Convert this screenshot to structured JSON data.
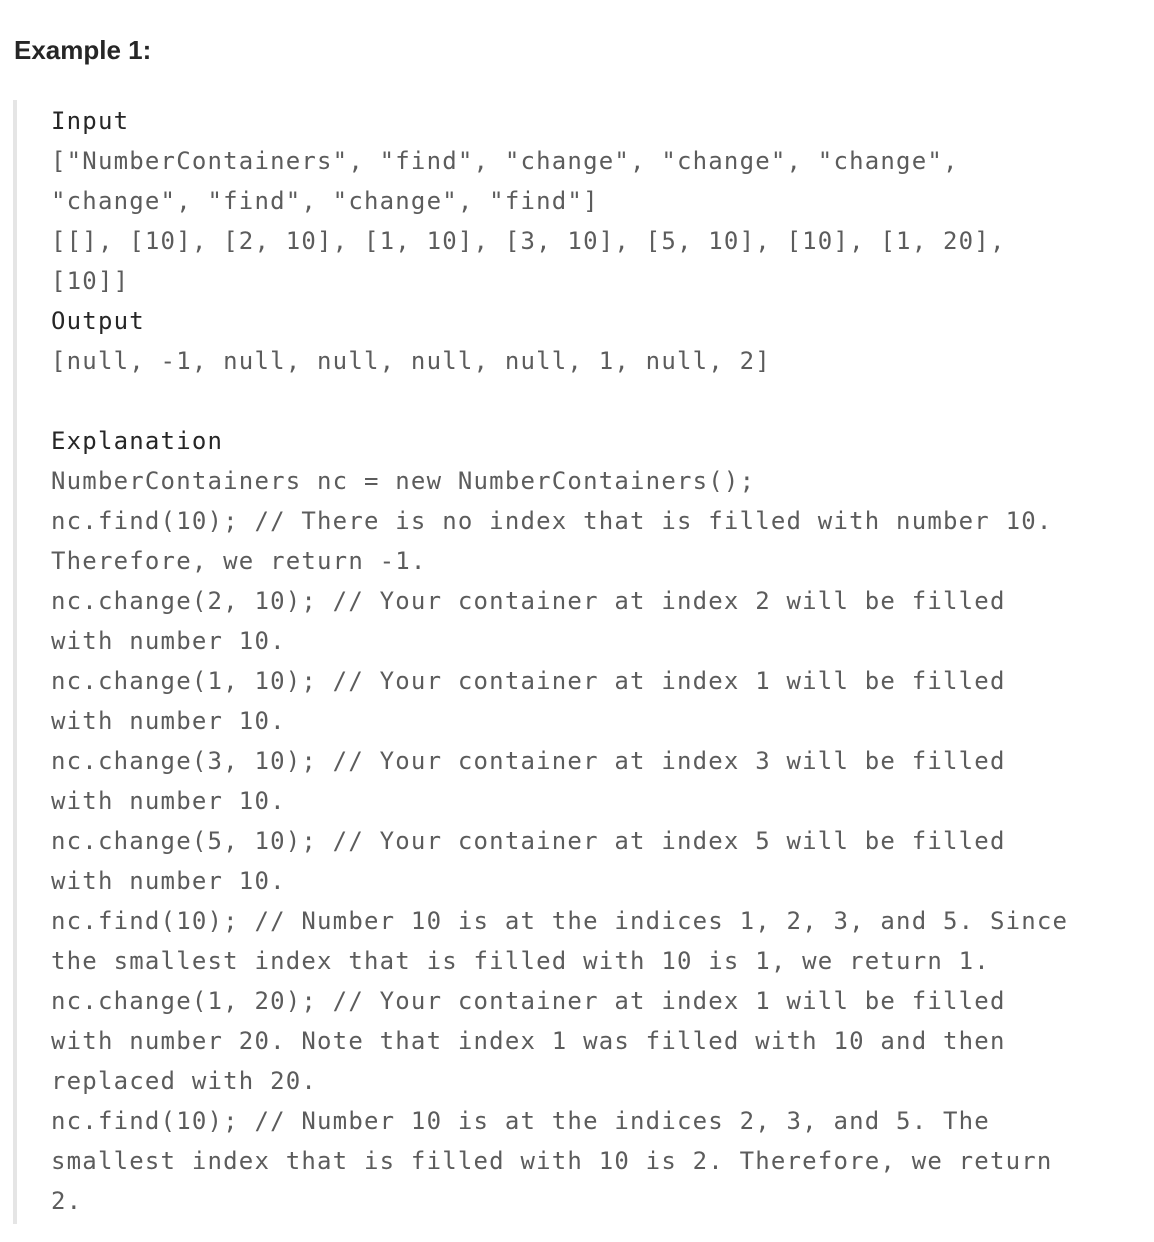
{
  "heading": "Example 1:",
  "input_label": "Input",
  "input_lines": [
    "[\"NumberContainers\", \"find\", \"change\", \"change\", \"change\",",
    "\"change\", \"find\", \"change\", \"find\"]",
    "[[], [10], [2, 10], [1, 10], [3, 10], [5, 10], [10], [1, 20],",
    "[10]]"
  ],
  "output_label": "Output",
  "output_lines": [
    "[null, -1, null, null, null, null, 1, null, 2]"
  ],
  "explanation_label": "Explanation",
  "explanation_lines": [
    "NumberContainers nc = new NumberContainers();",
    "nc.find(10); // There is no index that is filled with number 10.",
    "Therefore, we return -1.",
    "nc.change(2, 10); // Your container at index 2 will be filled",
    "with number 10.",
    "nc.change(1, 10); // Your container at index 1 will be filled",
    "with number 10.",
    "nc.change(3, 10); // Your container at index 3 will be filled",
    "with number 10.",
    "nc.change(5, 10); // Your container at index 5 will be filled",
    "with number 10.",
    "nc.find(10); // Number 10 is at the indices 1, 2, 3, and 5. Since",
    "the smallest index that is filled with 10 is 1, we return 1.",
    "nc.change(1, 20); // Your container at index 1 will be filled",
    "with number 20. Note that index 1 was filled with 10 and then",
    "replaced with 20.",
    "nc.find(10); // Number 10 is at the indices 2, 3, and 5. The",
    "smallest index that is filled with 10 is 2. Therefore, we return",
    "2."
  ]
}
